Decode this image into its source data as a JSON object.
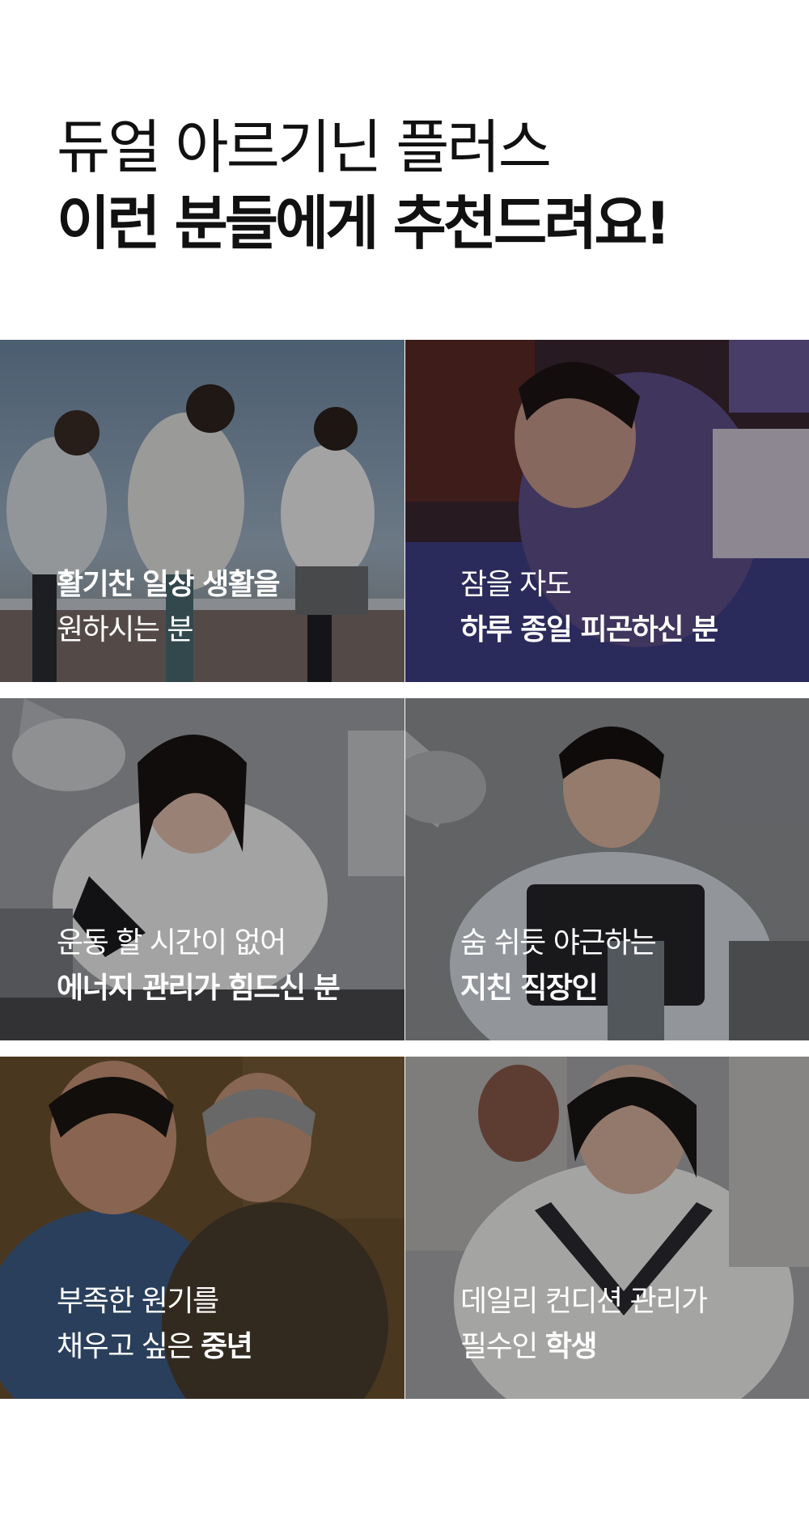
{
  "header": {
    "line1": "듀얼 아르기닌 플러스",
    "line2": "이런 분들에게 추천드려요!"
  },
  "cards": [
    {
      "line1_bold": "활기찬 일상 생활을",
      "line2_reg": "원하시는 분"
    },
    {
      "line1_reg": "잠을 자도",
      "line2_bold": "하루 종일 피곤하신 분"
    },
    {
      "line1_reg": "운동 할 시간이 없어",
      "line2_bold": "에너지 관리가 힘드신 분"
    },
    {
      "line1_reg": "숨 쉬듯 야근하는",
      "line2_bold": "지친 직장인"
    },
    {
      "line1_reg": "부족한 원기를",
      "line2_reg": "채우고 싶은 ",
      "line2_bold": "중년"
    },
    {
      "line1_reg": "데일리 컨디션 관리가",
      "line2_reg": "필수인 ",
      "line2_bold": "학생"
    }
  ]
}
